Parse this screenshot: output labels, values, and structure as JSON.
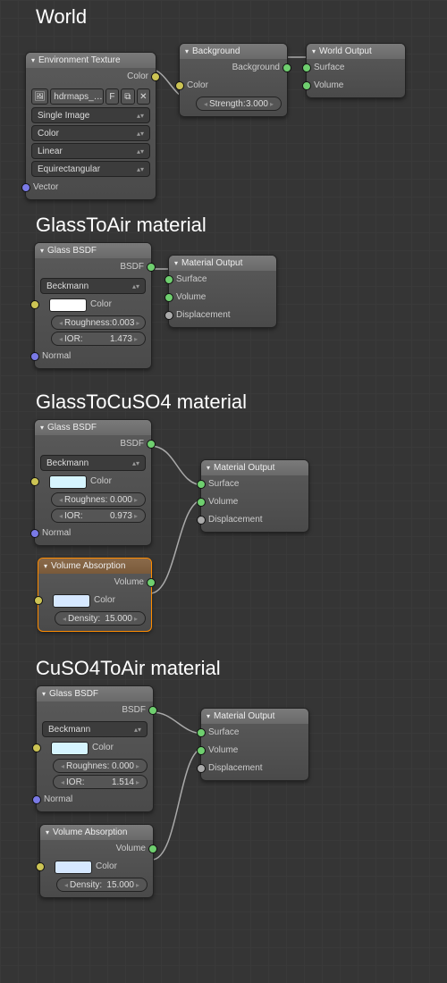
{
  "sections": {
    "world": "World",
    "mat1": "GlassToAir material",
    "mat2": "GlassToCuSO4 material",
    "mat3": "CuSO4ToAir material"
  },
  "env": {
    "header": "Environment Texture",
    "out_color": "Color",
    "file": "hdrmaps_…",
    "fbtn": "F",
    "mode": "Single Image",
    "cs": "Color",
    "interp": "Linear",
    "proj": "Equirectangular",
    "in_vec": "Vector"
  },
  "bg": {
    "header": "Background",
    "out": "Background",
    "in_color": "Color",
    "str_lbl": "Strength:",
    "str_val": "3.000"
  },
  "wout": {
    "header": "World Output",
    "surf": "Surface",
    "vol": "Volume"
  },
  "mout": {
    "header": "Material Output",
    "surf": "Surface",
    "vol": "Volume",
    "disp": "Displacement"
  },
  "g1": {
    "header": "Glass BSDF",
    "out": "BSDF",
    "dist": "Beckmann",
    "color_lbl": "Color",
    "swatch": "#ffffff",
    "rough_lbl": "Roughness:",
    "rough": "0.003",
    "ior_lbl": "IOR:",
    "ior": "1.473",
    "normal": "Normal"
  },
  "g2": {
    "header": "Glass BSDF",
    "out": "BSDF",
    "dist": "Beckmann",
    "color_lbl": "Color",
    "swatch": "#d6f5ff",
    "rough_lbl": "Roughnes:",
    "rough": "0.000",
    "ior_lbl": "IOR:",
    "ior": "0.973",
    "normal": "Normal"
  },
  "g3": {
    "header": "Glass BSDF",
    "out": "BSDF",
    "dist": "Beckmann",
    "color_lbl": "Color",
    "swatch": "#d6f5ff",
    "rough_lbl": "Roughnes:",
    "rough": "0.000",
    "ior_lbl": "IOR:",
    "ior": "1.514",
    "normal": "Normal"
  },
  "va2": {
    "header": "Volume Absorption",
    "out": "Volume",
    "color_lbl": "Color",
    "swatch": "#d6e8ff",
    "dens_lbl": "Density:",
    "dens": "15.000"
  },
  "va3": {
    "header": "Volume Absorption",
    "out": "Volume",
    "color_lbl": "Color",
    "swatch": "#d6e8ff",
    "dens_lbl": "Density:",
    "dens": "15.000"
  }
}
